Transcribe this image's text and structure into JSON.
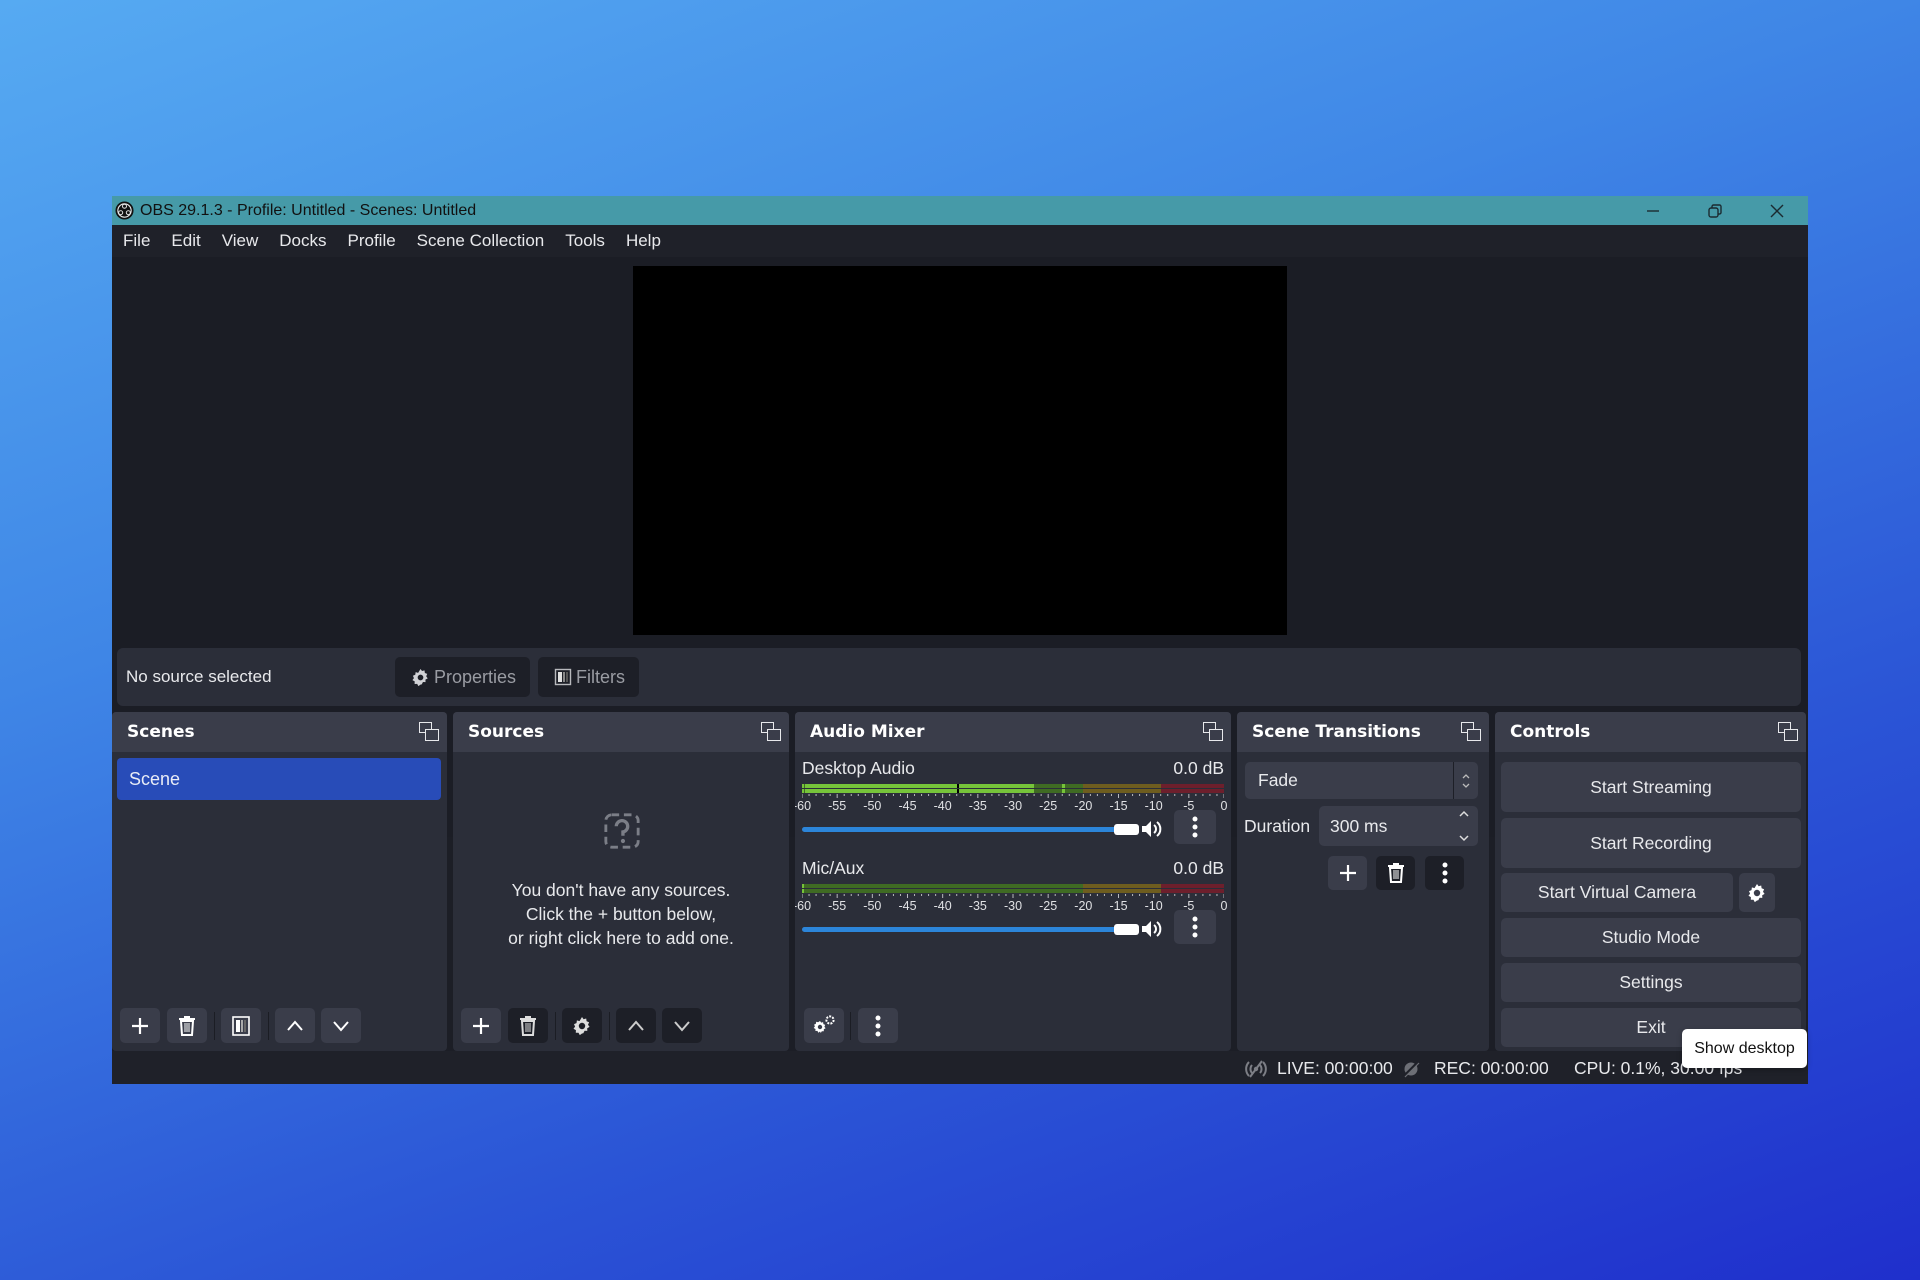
{
  "window": {
    "title": "OBS 29.1.3 - Profile: Untitled - Scenes: Untitled",
    "controls": [
      "minimize",
      "restore",
      "close"
    ]
  },
  "menu": [
    "File",
    "Edit",
    "View",
    "Docks",
    "Profile",
    "Scene Collection",
    "Tools",
    "Help"
  ],
  "context_bar": {
    "status": "No source selected",
    "properties_label": "Properties",
    "filters_label": "Filters"
  },
  "docks": {
    "scenes": {
      "title": "Scenes",
      "items": [
        "Scene"
      ],
      "selected": "Scene"
    },
    "sources": {
      "title": "Sources",
      "empty_lines": [
        "You don't have any sources.",
        "Click the + button below,",
        "or right click here to add one."
      ]
    },
    "audio_mixer": {
      "title": "Audio Mixer",
      "scale_labels": [
        "-60",
        "-55",
        "-50",
        "-45",
        "-40",
        "-35",
        "-30",
        "-25",
        "-20",
        "-15",
        "-10",
        "-5",
        "0"
      ],
      "channels": [
        {
          "name": "Desktop Audio",
          "db": "0.0 dB",
          "level_db": -27,
          "peak_db": -23,
          "volume": 1.0,
          "muted": false
        },
        {
          "name": "Mic/Aux",
          "db": "0.0 dB",
          "level_db": -60,
          "peak_db": -60,
          "volume": 1.0,
          "muted": false
        }
      ]
    },
    "scene_transitions": {
      "title": "Scene Transitions",
      "transition": "Fade",
      "duration_label": "Duration",
      "duration_value": "300 ms"
    },
    "controls": {
      "title": "Controls",
      "buttons": [
        "Start Streaming",
        "Start Recording",
        "Start Virtual Camera",
        "Studio Mode",
        "Settings",
        "Exit"
      ]
    }
  },
  "statusbar": {
    "live": "LIVE: 00:00:00",
    "rec": "REC: 00:00:00",
    "cpu": "CPU: 0.1%, 30.00 fps"
  },
  "tooltip": "Show desktop",
  "colors": {
    "titlebar": "#469aa8",
    "selection": "#284cb8",
    "slider": "#2c85d9",
    "meter_green": "#76c43a",
    "meter_yellow": "#6e5d1f",
    "meter_red": "#6d1f2c"
  }
}
